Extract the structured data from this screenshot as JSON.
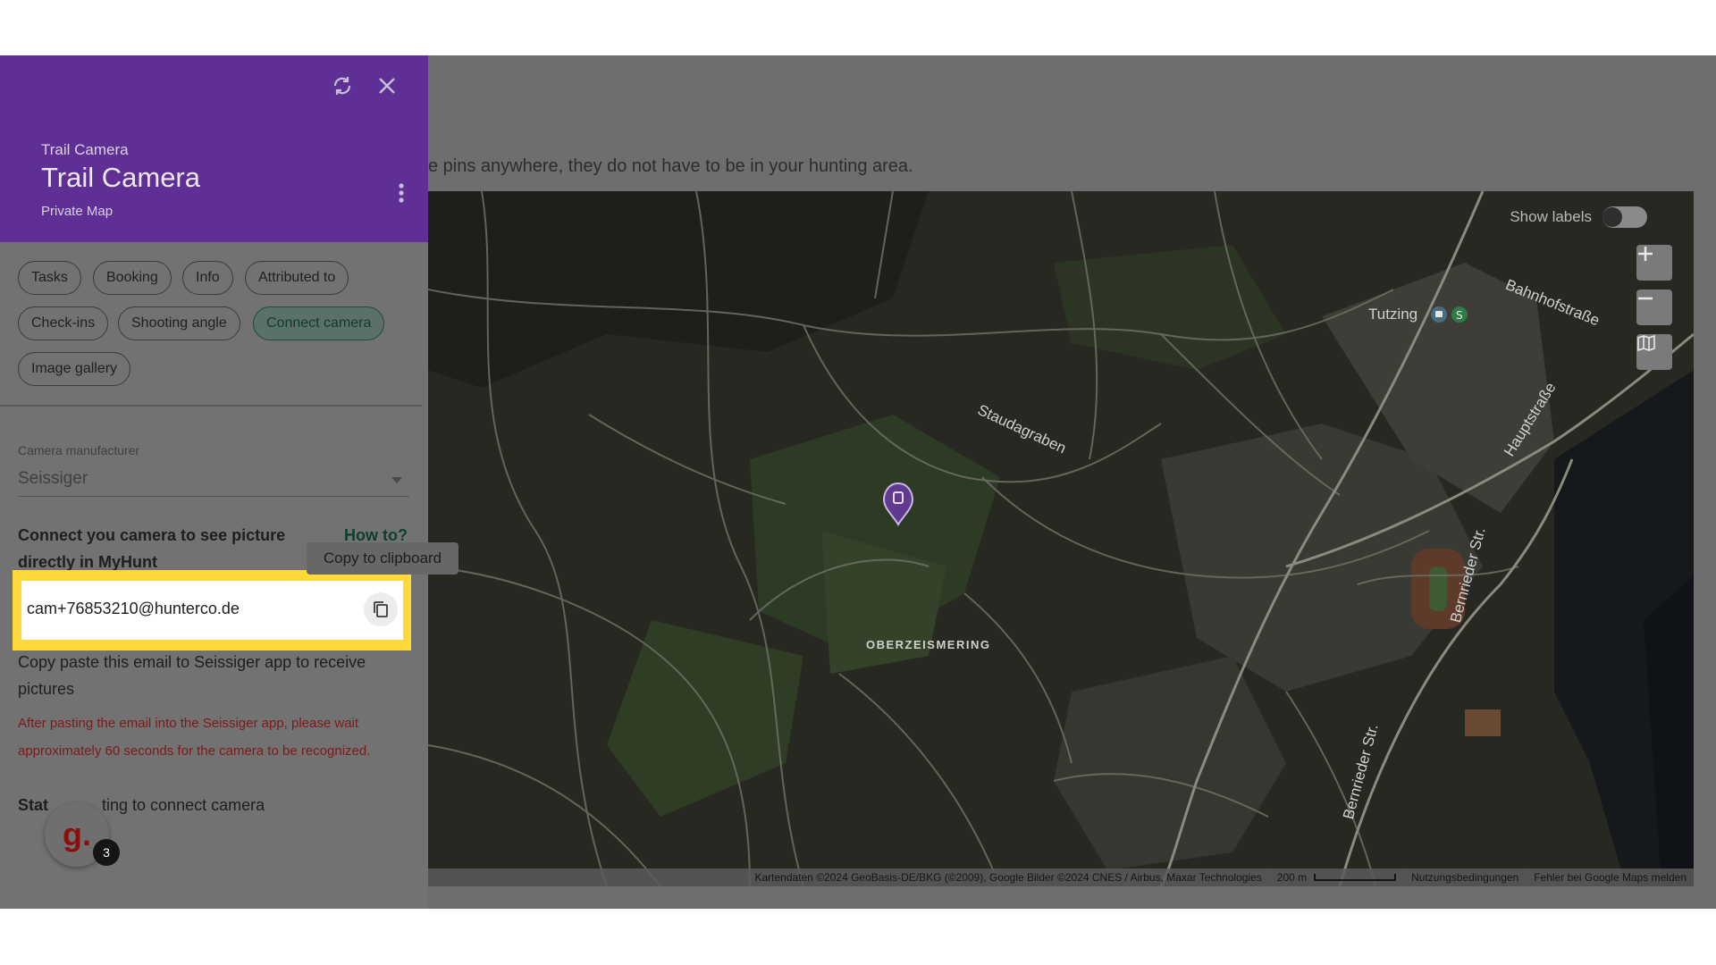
{
  "instruction_text": "e pins anywhere, they do not have to be in your hunting area.",
  "panel": {
    "subtitle": "Trail Camera",
    "title": "Trail Camera",
    "map_name": "Private Map",
    "tabs": [
      {
        "label": "Tasks",
        "active": false
      },
      {
        "label": "Booking",
        "active": false
      },
      {
        "label": "Info",
        "active": false
      },
      {
        "label": "Attributed to",
        "active": false
      },
      {
        "label": "Check-ins",
        "active": false
      },
      {
        "label": "Shooting angle",
        "active": false
      },
      {
        "label": "Connect camera",
        "active": true
      },
      {
        "label": "Image gallery",
        "active": false
      }
    ],
    "manufacturer_label": "Camera manufacturer",
    "manufacturer_value": "Seissiger",
    "connect_text": "Connect you camera to see picture directly in MyHunt",
    "how_to": "How to?",
    "tooltip": "Copy to clipboard",
    "email": "cam+76853210@hunterco.de",
    "copy_help": "Copy paste this email to Seissiger app to receive pictures",
    "warning": "After pasting the email into the Seissiger app, please wait approximately 60 seconds for the camera to be recognized.",
    "status_prefix": "Stat",
    "status_suffix": "ting to connect camera"
  },
  "map": {
    "show_labels": "Show labels",
    "labels_enabled": false,
    "place_labels": {
      "tutzing": "Tutzing",
      "bahnhofstrasse": "Bahnhofstraße",
      "staudagraben": "Staudagraben",
      "oberzeismering": "OBERZEISMERING",
      "hauptstrasse": "Hauptstraße",
      "bernrieder1": "Bernrieder Str.",
      "bernrieder2": "Bernrieder Str."
    },
    "attribution": "Kartendaten ©2024 GeoBasis-DE/BKG (©2009), Google Bilder ©2024 CNES / Airbus, Maxar Technologies",
    "scale": "200 m",
    "terms": "Nutzungsbedingungen",
    "report": "Fehler bei Google Maps melden"
  },
  "widget": {
    "letter": "g.",
    "count": "3"
  },
  "colors": {
    "header": "#5f2f95",
    "accent": "#0c3f2e",
    "highlight": "#ffd93a",
    "warning": "#7c1a1a"
  }
}
